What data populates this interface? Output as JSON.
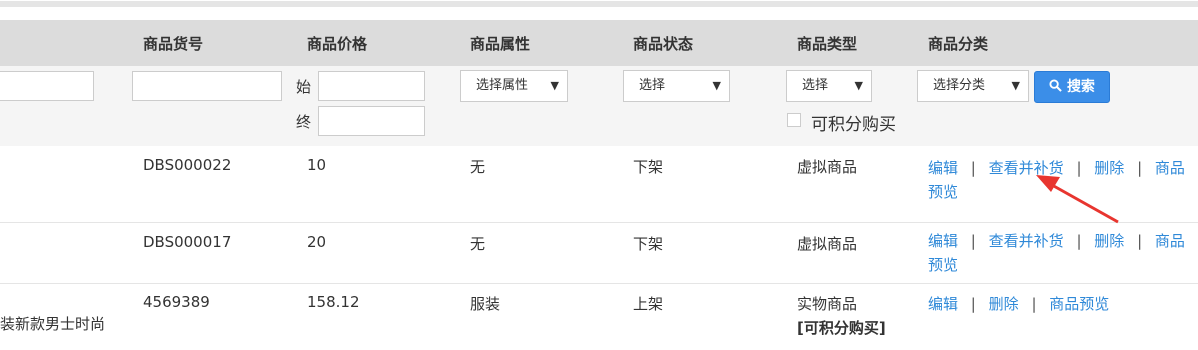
{
  "header": {
    "col_code": "商品货号",
    "col_price": "商品价格",
    "col_attr": "商品属性",
    "col_status": "商品状态",
    "col_type": "商品类型",
    "col_category": "商品分类"
  },
  "filters": {
    "price_start_label": "始",
    "price_end_label": "终",
    "attr_select": "选择属性",
    "status_select": "选择",
    "type_select": "选择",
    "points_checkbox_label": "可积分购买",
    "category_select": "选择分类",
    "search_button": "搜索"
  },
  "rows": [
    {
      "name": "",
      "code": "DBS000022",
      "price": "10",
      "attr": "无",
      "status": "下架",
      "type": "虚拟商品",
      "type_extra": "",
      "actions": {
        "edit": "编辑",
        "restock": "查看并补货",
        "delete": "删除",
        "preview_1": "商品",
        "preview_2": "预览"
      }
    },
    {
      "name": "",
      "code": "DBS000017",
      "price": "20",
      "attr": "无",
      "status": "下架",
      "type": "虚拟商品",
      "type_extra": "",
      "actions": {
        "edit": "编辑",
        "restock": "查看并补货",
        "delete": "删除",
        "preview_1": "商品",
        "preview_2": "预览"
      }
    },
    {
      "name": "装新款男士时尚",
      "code": "4569389",
      "price": "158.12",
      "attr": "服装",
      "status": "上架",
      "type": "实物商品",
      "type_extra": "[可积分购买]",
      "actions": {
        "edit": "编辑",
        "delete": "删除",
        "preview": "商品预览"
      }
    }
  ],
  "separator": "|",
  "colors": {
    "header_bg": "#dcdcdc",
    "link": "#2f89d8",
    "button": "#3b8ee8",
    "annotation_arrow": "#e8352f"
  }
}
